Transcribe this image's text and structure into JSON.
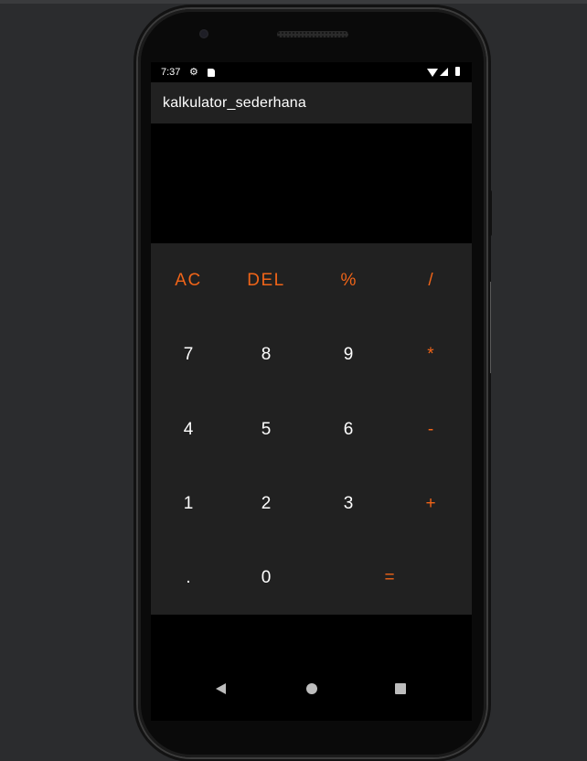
{
  "status_bar": {
    "time": "7:37",
    "settings_icon": "gear-icon",
    "sd_icon": "sd-card-icon",
    "wifi_icon": "wifi-icon",
    "signal_icon": "signal-icon",
    "battery_icon": "battery-icon"
  },
  "app_bar": {
    "title": "kalkulator_sederhana"
  },
  "display": {
    "value": ""
  },
  "keypad": {
    "rows": [
      [
        "AC",
        "DEL",
        "%",
        "/"
      ],
      [
        "7",
        "8",
        "9",
        "*"
      ],
      [
        "4",
        "5",
        "6",
        "-"
      ],
      [
        "1",
        "2",
        "3",
        "+"
      ],
      [
        ".",
        "0",
        "="
      ]
    ]
  },
  "nav_bar": {
    "back_icon": "back-triangle-icon",
    "home_icon": "home-circle-icon",
    "recents_icon": "recents-square-icon"
  },
  "colors": {
    "accent": "#f06418",
    "keypad_bg": "#212121",
    "app_bar_bg": "#212121",
    "screen_bg": "#000000",
    "desktop_bg": "#2b2c2e"
  }
}
